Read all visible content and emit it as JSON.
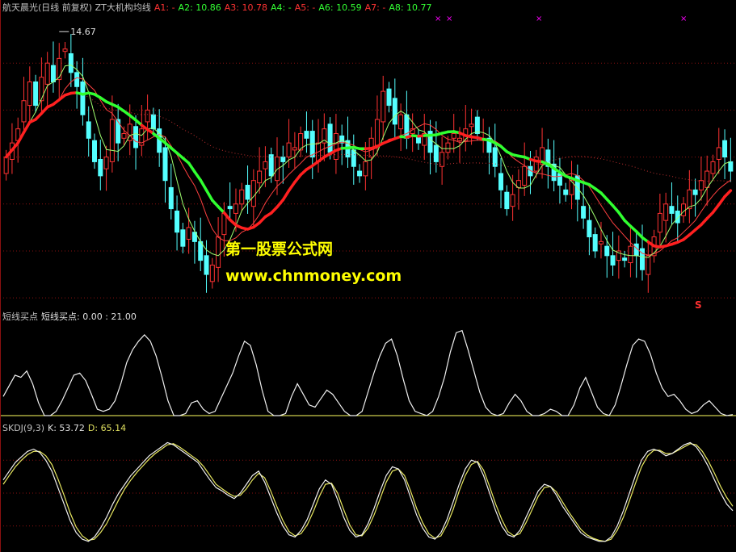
{
  "main_header": {
    "title": "航天晨光(日线 前复权) ZT大机构均线",
    "items": [
      {
        "label": "A1: -",
        "color": "#ff3333"
      },
      {
        "label": "A2: 10.86",
        "color": "#33ff33"
      },
      {
        "label": "A3: 10.78",
        "color": "#ff3333"
      },
      {
        "label": "A4: -",
        "color": "#33ff33"
      },
      {
        "label": "A5: -",
        "color": "#ff3333"
      },
      {
        "label": "A6: 10.59",
        "color": "#33ff33"
      },
      {
        "label": "A7: -",
        "color": "#ff3333"
      },
      {
        "label": "A8: 10.77",
        "color": "#33ff33"
      }
    ]
  },
  "high_label": "14.67",
  "signal_label": "S",
  "watermark": {
    "line1": "第一股票公式网",
    "line2": "www.chnmoney.com"
  },
  "buy_header": {
    "title": "短线买点",
    "value": "短线买点: 0.00 : 21.00"
  },
  "kdj_header": {
    "title": "SKDJ(9,3)",
    "k": "K: 53.72",
    "d": "D: 65.14"
  },
  "colors": {
    "up": "#ff3232",
    "down": "#54ffff",
    "ma_red": "#ff2020",
    "ma_green": "#30ff30",
    "grid": "#8a1010",
    "text": "#c0c0c0"
  },
  "chart_data": {
    "type": "candlestick",
    "price_range": [
      8.9,
      15.0
    ],
    "closes": [
      12.0,
      12.3,
      12.6,
      13.2,
      13.6,
      13.1,
      13.7,
      14.0,
      13.6,
      14.1,
      14.3,
      13.8,
      13.5,
      12.9,
      12.4,
      11.9,
      11.6,
      12.0,
      12.8,
      12.3,
      12.5,
      12.7,
      12.2,
      12.6,
      13.0,
      12.6,
      12.1,
      11.5,
      10.9,
      10.4,
      10.1,
      10.5,
      10.2,
      9.8,
      9.5,
      9.7,
      10.3,
      10.8,
      10.9,
      11.0,
      11.3,
      11.1,
      11.5,
      11.7,
      11.9,
      11.6,
      12.0,
      11.9,
      12.3,
      12.2,
      12.5,
      12.4,
      12.0,
      12.3,
      12.6,
      12.1,
      12.5,
      12.3,
      12.0,
      11.8,
      11.6,
      11.9,
      12.4,
      12.8,
      13.4,
      13.1,
      12.7,
      12.9,
      12.4,
      12.6,
      12.3,
      12.5,
      12.1,
      11.9,
      12.1,
      12.3,
      12.5,
      12.4,
      12.6,
      12.7,
      12.5,
      12.4,
      12.1,
      11.8,
      11.3,
      10.9,
      11.2,
      11.5,
      11.8,
      11.6,
      12.0,
      12.2,
      11.8,
      11.5,
      11.4,
      11.2,
      11.5,
      11.1,
      10.7,
      10.3,
      10.0,
      10.2,
      9.9,
      9.7,
      10.0,
      9.8,
      10.1,
      9.9,
      9.6,
      9.9,
      10.3,
      10.8,
      11.0,
      10.8,
      10.6,
      11.0,
      11.3,
      11.2,
      11.5,
      11.7,
      11.9,
      12.2,
      12.0,
      11.7
    ],
    "buy_signal": [
      18,
      28,
      38,
      36,
      42,
      30,
      12,
      0,
      0,
      4,
      14,
      26,
      38,
      40,
      33,
      20,
      6,
      4,
      6,
      14,
      30,
      50,
      62,
      70,
      76,
      70,
      56,
      36,
      14,
      0,
      0,
      2,
      12,
      14,
      6,
      2,
      4,
      16,
      28,
      40,
      56,
      70,
      66,
      48,
      24,
      4,
      0,
      0,
      2,
      18,
      30,
      20,
      10,
      8,
      16,
      24,
      20,
      12,
      4,
      0,
      0,
      4,
      22,
      40,
      56,
      68,
      72,
      56,
      34,
      14,
      4,
      2,
      0,
      4,
      18,
      36,
      60,
      78,
      80,
      62,
      42,
      22,
      8,
      2,
      0,
      2,
      12,
      20,
      14,
      4,
      0,
      0,
      2,
      6,
      4,
      0,
      0,
      10,
      26,
      36,
      22,
      8,
      2,
      0,
      10,
      28,
      48,
      66,
      72,
      70,
      58,
      40,
      26,
      18,
      20,
      14,
      6,
      2,
      4,
      10,
      14,
      8,
      2,
      0,
      1
    ],
    "skdj_k": [
      62,
      70,
      78,
      83,
      88,
      90,
      87,
      80,
      70,
      55,
      40,
      25,
      14,
      8,
      6,
      10,
      18,
      28,
      40,
      50,
      58,
      66,
      72,
      78,
      84,
      88,
      92,
      96,
      94,
      90,
      86,
      82,
      78,
      70,
      62,
      55,
      52,
      48,
      45,
      50,
      58,
      66,
      70,
      60,
      46,
      32,
      20,
      12,
      10,
      16,
      26,
      40,
      54,
      62,
      58,
      44,
      28,
      16,
      10,
      12,
      22,
      36,
      52,
      66,
      74,
      72,
      62,
      46,
      30,
      18,
      10,
      8,
      14,
      26,
      42,
      58,
      72,
      80,
      78,
      66,
      50,
      34,
      20,
      12,
      10,
      16,
      28,
      40,
      52,
      58,
      56,
      48,
      38,
      30,
      22,
      14,
      10,
      8,
      6,
      6,
      10,
      20,
      34,
      50,
      66,
      80,
      88,
      90,
      88,
      84,
      86,
      90,
      94,
      96,
      92,
      84,
      74,
      62,
      50,
      40,
      34
    ],
    "skdj_d": [
      58,
      66,
      74,
      80,
      85,
      88,
      88,
      84,
      76,
      63,
      48,
      32,
      19,
      11,
      7,
      8,
      14,
      22,
      33,
      44,
      54,
      62,
      69,
      75,
      81,
      86,
      90,
      94,
      95,
      92,
      88,
      84,
      80,
      74,
      66,
      58,
      54,
      50,
      47,
      48,
      54,
      62,
      68,
      64,
      52,
      38,
      25,
      15,
      11,
      13,
      21,
      33,
      47,
      58,
      59,
      50,
      35,
      21,
      12,
      11,
      18,
      30,
      45,
      60,
      70,
      72,
      66,
      52,
      36,
      23,
      13,
      9,
      11,
      21,
      35,
      52,
      66,
      76,
      79,
      71,
      56,
      40,
      26,
      15,
      11,
      13,
      23,
      35,
      47,
      55,
      56,
      51,
      42,
      33,
      25,
      17,
      12,
      9,
      7,
      6,
      8,
      16,
      28,
      43,
      59,
      74,
      84,
      89,
      89,
      86,
      86,
      89,
      92,
      95,
      94,
      88,
      79,
      68,
      56,
      46,
      38
    ],
    "annotations": [
      "14.67",
      "S"
    ]
  }
}
